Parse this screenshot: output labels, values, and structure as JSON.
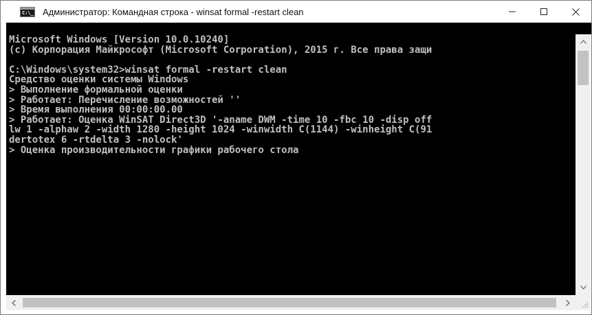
{
  "window": {
    "title": "Администратор: Командная строка - winsat  formal -restart clean",
    "app_icon_glyph": "C:\\_"
  },
  "console": {
    "background": "#000000",
    "foreground": "#c0c0c0",
    "lines": [
      "Microsoft Windows [Version 10.0.10240]",
      "(c) Корпорация Майкрософт (Microsoft Corporation), 2015 г. Все права защи",
      "",
      "C:\\Windows\\system32>winsat formal -restart clean",
      "Средство оценки системы Windows",
      "> Выполнение формальной оценки",
      "> Работает: Перечисление возможностей ''",
      "> Время выполнения 00:00:00.00",
      "> Работает: Оценка WinSAT Direct3D '-aname DWM -time 10 -fbc 10 -disp off",
      "lw 1 -alphaw 2 -width 1280 -height 1024 -winwidth C(1144) -winheight C(91",
      "dertotex 6 -rtdelta 3 -nolock'",
      "> Оценка производительности графики рабочего стола"
    ]
  },
  "icons": {
    "minimize": "minimize-icon",
    "maximize": "maximize-icon",
    "close": "close-icon",
    "scroll_up": "chevron-up-icon",
    "scroll_down": "chevron-down-icon",
    "scroll_left": "chevron-left-icon",
    "scroll_right": "chevron-right-icon"
  }
}
